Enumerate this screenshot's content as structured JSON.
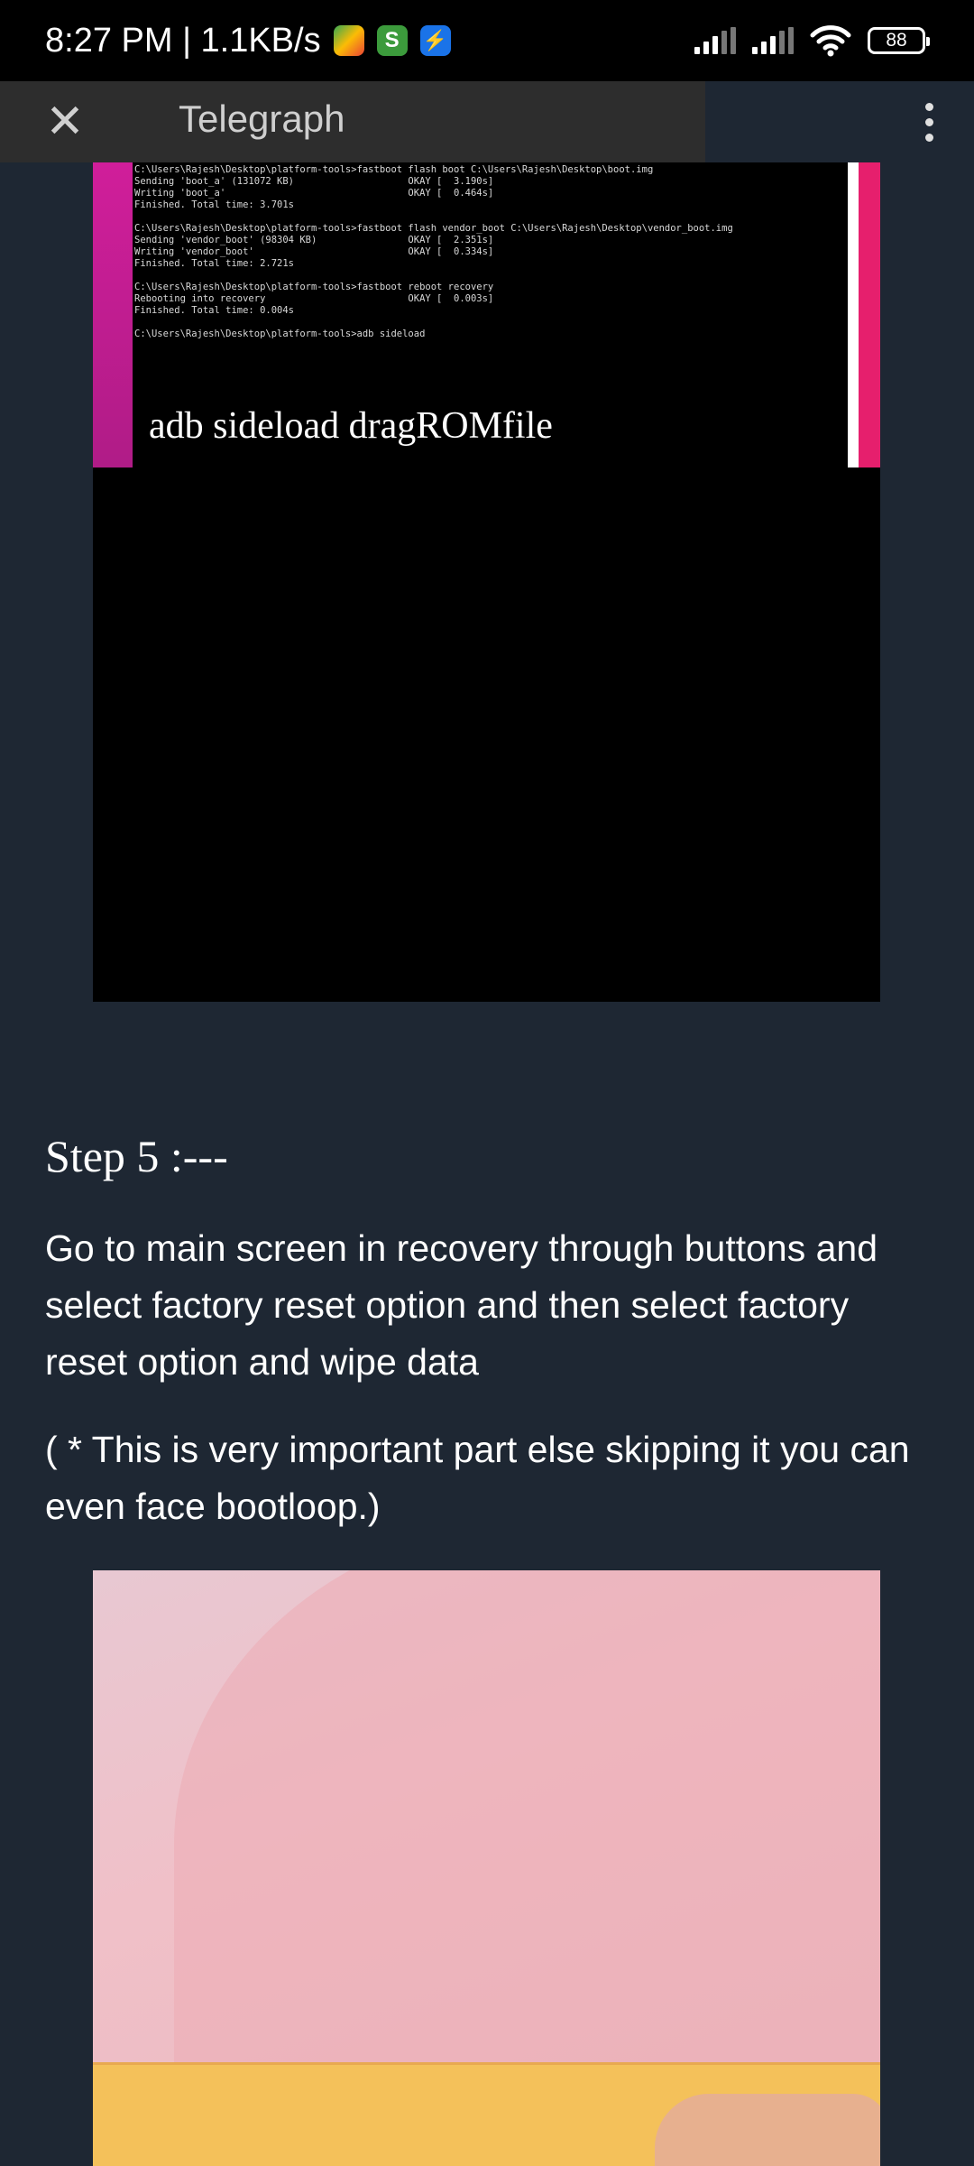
{
  "status_bar": {
    "time_speed": "8:27 PM | 1.1KB/s",
    "battery": "88"
  },
  "app_bar": {
    "title": "Telegraph",
    "close_icon": "close-icon",
    "menu_icon": "more-vert-icon"
  },
  "terminal_image": {
    "lines": [
      "C:\\Users\\Rajesh\\Desktop\\platform-tools>fastboot flash boot C:\\Users\\Rajesh\\Desktop\\boot.img",
      "Sending 'boot_a' (131072 KB)                    OKAY [  3.190s]",
      "Writing 'boot_a'                                OKAY [  0.464s]",
      "Finished. Total time: 3.701s",
      "",
      "C:\\Users\\Rajesh\\Desktop\\platform-tools>fastboot flash vendor_boot C:\\Users\\Rajesh\\Desktop\\vendor_boot.img",
      "Sending 'vendor_boot' (98304 KB)                OKAY [  2.351s]",
      "Writing 'vendor_boot'                           OKAY [  0.334s]",
      "Finished. Total time: 2.721s",
      "",
      "C:\\Users\\Rajesh\\Desktop\\platform-tools>fastboot reboot recovery",
      "Rebooting into recovery                         OKAY [  0.003s]",
      "Finished. Total time: 0.004s",
      "",
      "C:\\Users\\Rajesh\\Desktop\\platform-tools>adb sideload"
    ],
    "caption": "adb sideload dragROMfile"
  },
  "article": {
    "step_heading": "Step 5 :---",
    "paragraph_1": "Go to main screen in recovery through buttons and select factory reset option and then select factory reset option and wipe data",
    "paragraph_2": "( * This is very important part else skipping it you can even face bootloop.)"
  }
}
